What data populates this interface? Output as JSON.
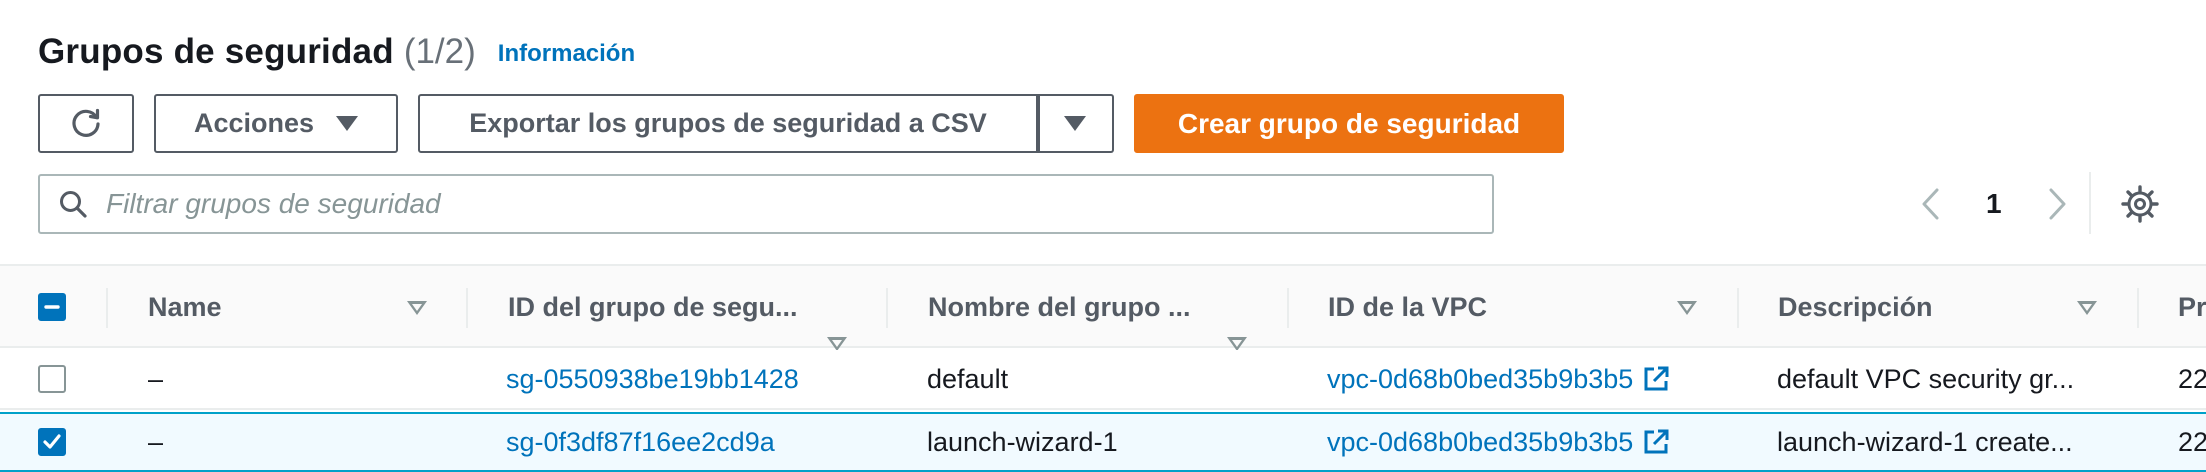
{
  "header": {
    "title": "Grupos de seguridad",
    "count": "(1/2)",
    "info_link": "Información"
  },
  "toolbar": {
    "refresh_icon": "refresh-icon",
    "actions_label": "Acciones",
    "export_label": "Exportar los grupos de seguridad a CSV",
    "create_label": "Crear grupo de seguridad"
  },
  "filter": {
    "placeholder": "Filtrar grupos de seguridad",
    "value": ""
  },
  "pagination": {
    "current_page": "1"
  },
  "table": {
    "columns": [
      "Name",
      "ID del grupo de segu...",
      "Nombre del grupo ...",
      "ID de la VPC",
      "Descripción",
      "Pr"
    ],
    "rows": [
      {
        "selected": false,
        "name": "–",
        "group_id": "sg-0550938be19bb1428",
        "group_name": "default",
        "vpc_id": "vpc-0d68b0bed35b9b3b5",
        "description": "default VPC security gr...",
        "extra": "22"
      },
      {
        "selected": true,
        "name": "–",
        "group_id": "sg-0f3df87f16ee2cd9a",
        "group_name": "launch-wizard-1",
        "vpc_id": "vpc-0d68b0bed35b9b3b5",
        "description": "launch-wizard-1 create...",
        "extra": "22"
      }
    ]
  },
  "colors": {
    "accent_orange": "#ec7211",
    "link_blue": "#0073bb",
    "selected_border": "#00a1c9",
    "selected_bg": "#f1faff"
  }
}
